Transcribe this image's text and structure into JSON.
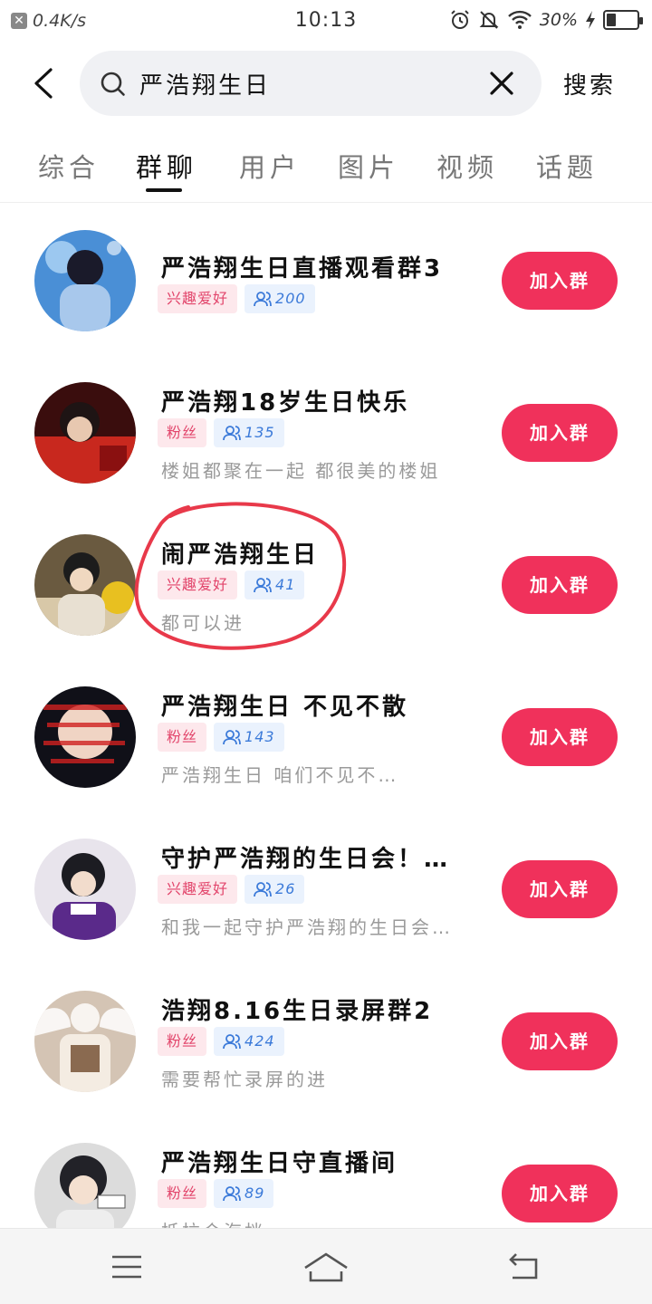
{
  "status": {
    "net_speed": "0.4K/s",
    "time": "10:13",
    "battery_pct": "30%",
    "battery_level": 0.3
  },
  "search": {
    "query": "严浩翔生日",
    "button_label": "搜索"
  },
  "tabs": [
    {
      "label": "综合",
      "active": false
    },
    {
      "label": "群聊",
      "active": true
    },
    {
      "label": "用户",
      "active": false
    },
    {
      "label": "图片",
      "active": false
    },
    {
      "label": "视频",
      "active": false
    },
    {
      "label": "话题",
      "active": false
    }
  ],
  "groups": [
    {
      "title": "严浩翔生日直播观看群3",
      "tag": "兴趣爱好",
      "members": "200",
      "desc": "",
      "button": "加入群"
    },
    {
      "title": "严浩翔18岁生日快乐",
      "tag": "粉丝",
      "members": "135",
      "desc": "楼姐都聚在一起 都很美的楼姐",
      "button": "加入群"
    },
    {
      "title": "闹严浩翔生日",
      "tag": "兴趣爱好",
      "members": "41",
      "desc": "都可以进",
      "button": "加入群"
    },
    {
      "title": "严浩翔生日 不见不散",
      "tag": "粉丝",
      "members": "143",
      "desc": "严浩翔生日 咱们不见不…",
      "button": "加入群"
    },
    {
      "title": "守护严浩翔的生日会！…",
      "tag": "兴趣爱好",
      "members": "26",
      "desc": "和我一起守护严浩翔的生日会…",
      "button": "加入群"
    },
    {
      "title": "浩翔8.16生日录屏群2",
      "tag": "粉丝",
      "members": "424",
      "desc": "需要帮忙录屏的进",
      "button": "加入群"
    },
    {
      "title": "严浩翔生日守直播间",
      "tag": "粉丝",
      "members": "89",
      "desc": "抵拉会海档…",
      "button": "加入群"
    }
  ],
  "colors": {
    "accent": "#f0315b",
    "tag_pink_bg": "#fde8ec",
    "tag_blue_bg": "#eaf2fd",
    "annotation_red": "#e8394a"
  }
}
